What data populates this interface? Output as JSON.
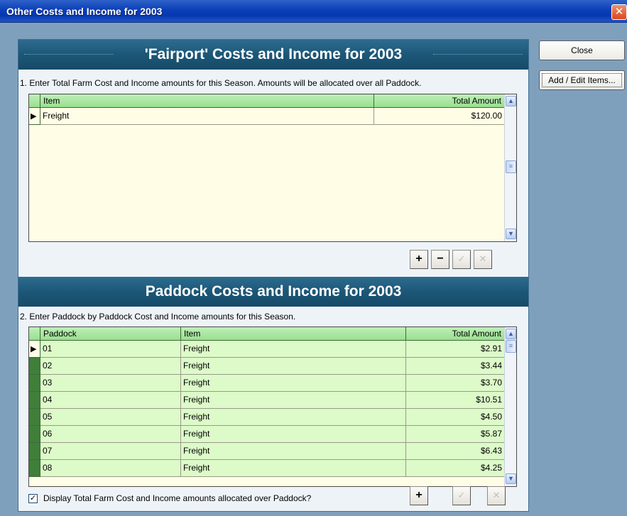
{
  "window": {
    "title": "Other Costs and Income for 2003",
    "close_glyph": "✕"
  },
  "side_buttons": {
    "close_label": "Close",
    "add_edit_label": "Add / Edit Items..."
  },
  "farm_section": {
    "header": "'Fairport' Costs and Income for 2003",
    "instruction": "1. Enter Total Farm Cost and Income amounts for this Season. Amounts will be allocated over all Paddock.",
    "columns": {
      "item": "Item",
      "total": "Total Amount"
    },
    "rows": [
      {
        "item": "Freight",
        "total": "$120.00"
      }
    ],
    "toolbar": {
      "add": "+",
      "remove": "−",
      "post": "✓",
      "cancel": "✕"
    }
  },
  "paddock_section": {
    "header": "Paddock Costs and Income for 2003",
    "instruction": "2. Enter Paddock by Paddock Cost and Income amounts for this Season.",
    "columns": {
      "paddock": "Paddock",
      "item": "Item",
      "total": "Total Amount"
    },
    "rows": [
      {
        "paddock": "01",
        "item": "Freight",
        "total": "$2.91"
      },
      {
        "paddock": "02",
        "item": "Freight",
        "total": "$3.44"
      },
      {
        "paddock": "03",
        "item": "Freight",
        "total": "$3.70"
      },
      {
        "paddock": "04",
        "item": "Freight",
        "total": "$10.51"
      },
      {
        "paddock": "05",
        "item": "Freight",
        "total": "$4.50"
      },
      {
        "paddock": "06",
        "item": "Freight",
        "total": "$5.87"
      },
      {
        "paddock": "07",
        "item": "Freight",
        "total": "$6.43"
      },
      {
        "paddock": "08",
        "item": "Freight",
        "total": "$4.25"
      }
    ],
    "checkbox_label": "Display Total Farm Cost and Income amounts allocated over Paddock?",
    "checkbox_checked": true,
    "toolbar": {
      "add": "+",
      "post": "✓",
      "cancel": "✕"
    }
  },
  "colors": {
    "title_bar": "#0a3fb7",
    "section_header": "#1c5777",
    "grid_header": "#98df8f",
    "paddock_row": "#ddfac9",
    "farm_grid_bg": "#fffde6",
    "client_bg": "#7fa0bd"
  },
  "icons": {
    "scroll_up": "▲",
    "scroll_down": "▼",
    "scroll_thumb": "≡",
    "current_row": "▶",
    "check": "✓"
  }
}
